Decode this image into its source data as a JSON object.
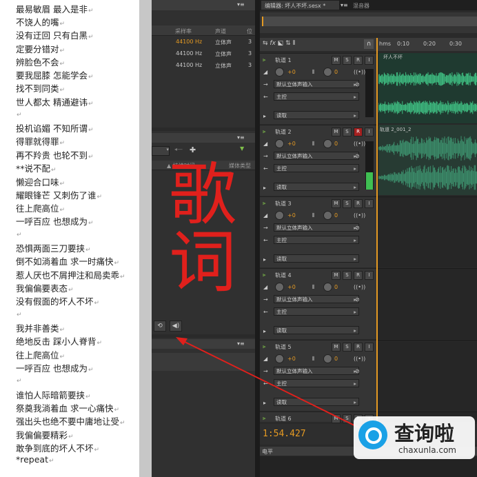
{
  "lyrics": [
    "最易敏眉  最入是非",
    "不饶人的嘴",
    "没有迂回  只有白黑",
    "定要分错对",
    "辨脸色不会",
    "要我屈膝  怎能学会",
    "找不到同类",
    "世人都太  精通避讳",
    "",
    "投机谄媚  不知所谓",
    "得罪就得罪",
    "再不羚贵  也轮不到",
    "**说不配",
    "懒迎合口味",
    "耀眼锋芒  又刺伤了谁",
    "往上爬高位",
    "一呼百应  也想成为",
    "",
    "恐惧两面三刀要挟",
    "倒不如淌着血  求一时痛快",
    "惹人厌也不屑押注和局卖乖",
    "我偏偏要表态",
    "没有假面的坏人不坏",
    "",
    "我并非善类",
    "绝地反击  踩小人脊背",
    "往上爬高位",
    "一呼百应  也想成为",
    "",
    "谁怕人际暗箭要挟",
    "祭奠我淌着血  求一心痛快",
    "强出头也绝不要中庸地让受",
    "我偏偏要精彩",
    "敢争到底的坏人不坏",
    "*repeat"
  ],
  "files_panel": {
    "columns": [
      "采样率",
      "声道",
      "位"
    ],
    "rows": [
      {
        "rate": "44100 Hz",
        "channels": "立体声",
        "bits": "3"
      },
      {
        "rate": "44100 Hz",
        "channels": "立体声",
        "bits": "3"
      },
      {
        "rate": "44100 Hz",
        "channels": "立体声",
        "bits": "3"
      }
    ]
  },
  "media_panel": {
    "col1": "持续时间",
    "col2": "媒体类型"
  },
  "editor": {
    "tab_label": "编辑器: 坏人不坏.sesx *",
    "tab2_label": "混音器",
    "ruler": [
      "hms",
      "0:10",
      "0:20",
      "0:30"
    ],
    "clip1_label": "坏人不坏",
    "clip2_label": "轨道 2_001_2",
    "time_display": "1:54.427",
    "bottom_label": "电平"
  },
  "tracks": [
    {
      "name": "轨道 1",
      "input": "默认立体声输入",
      "output": "主控",
      "mode": "读取",
      "vol": "+0",
      "pan": "0",
      "armed": false
    },
    {
      "name": "轨道 2",
      "input": "默认立体声输入",
      "output": "主控",
      "mode": "读取",
      "vol": "+0",
      "pan": "0",
      "armed": true
    },
    {
      "name": "轨道 3",
      "input": "默认立体声输入",
      "output": "主控",
      "mode": "读取",
      "vol": "+0",
      "pan": "0",
      "armed": false
    },
    {
      "name": "轨道 4",
      "input": "默认立体声输入",
      "output": "主控",
      "mode": "读取",
      "vol": "+0",
      "pan": "0",
      "armed": false
    },
    {
      "name": "轨道 5",
      "input": "默认立体声输入",
      "output": "主控",
      "mode": "读取",
      "vol": "+0",
      "pan": "0",
      "armed": false
    },
    {
      "name": "轨道 6"
    }
  ],
  "btn_labels": {
    "m": "M",
    "s": "S",
    "r": "R",
    "i": "I"
  },
  "annotation": {
    "text": "歌词",
    "color": "#e0201c"
  },
  "watermark": {
    "name": "查询啦",
    "url": "chaxunla.com"
  },
  "colors": {
    "waveform": "#3fbf82",
    "accent": "#e59a23",
    "record": "#a52020"
  }
}
